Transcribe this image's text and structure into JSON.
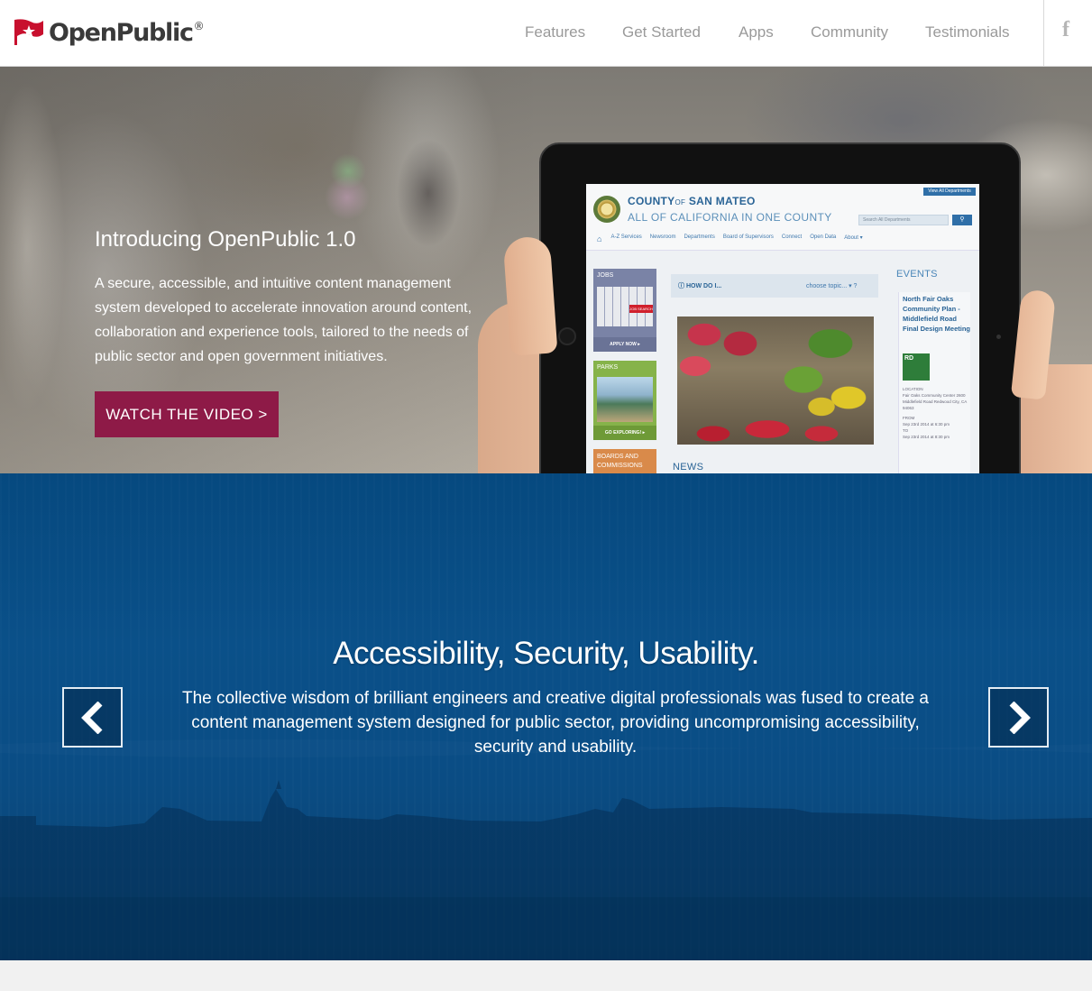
{
  "header": {
    "logo_text": "OpenPublic",
    "logo_reg": "®",
    "nav": [
      {
        "label": "Features"
      },
      {
        "label": "Get Started"
      },
      {
        "label": "Apps"
      },
      {
        "label": "Community"
      },
      {
        "label": "Testimonials"
      }
    ],
    "social_icon": "facebook-icon",
    "social_glyph": "f"
  },
  "hero": {
    "title": "Introducing OpenPublic 1.0",
    "description": "A secure, accessible, and intuitive content management system developed to accelerate innovation around content, collaboration and experience tools, tailored to the needs of public sector and open government initiatives.",
    "cta_label": "WATCH THE VIDEO >",
    "cta_color": "#8e1a47"
  },
  "tablet_screen": {
    "county_prefix": "COUNTY",
    "county_of": "OF",
    "county_name": "SAN MATEO",
    "tagline": "ALL OF CALIFORNIA IN ONE COUNTY",
    "all_departments": "View All Departments",
    "search_placeholder": "Search All Departments",
    "nav": [
      "A-Z Services",
      "Newsroom",
      "Departments",
      "Board of Supervisors",
      "Connect",
      "Open Data",
      "About ▾"
    ],
    "tiles": [
      {
        "label": "JOBS",
        "action": "APPLY NOW ▸"
      },
      {
        "label": "PARKS",
        "action": "GO EXPLORING! ▸"
      },
      {
        "label": "BOARDS AND COMMISSIONS",
        "action": ""
      }
    ],
    "job_search": "JOB SEARCH",
    "how_do_i": "HOW DO I...",
    "choose_topic": "choose topic... ▾  ?",
    "events_heading": "EVENTS",
    "event_title": "North Fair Oaks Community Plan - Middlefield Road Final Design Meeting",
    "event_location_label": "LOCATION",
    "event_location": "Fair Oaks Community Center 2600 Middlefield Road Redwood City, CA 94063",
    "event_from_label": "FROM",
    "event_from": "Sep 23rd 2014 at 6:30 pm",
    "event_to_label": "TO",
    "event_to": "Sep 23rd 2014 at 8:30 pm",
    "news_heading": "NEWS"
  },
  "feature": {
    "title": "Accessibility, Security, Usability.",
    "description": "The collective wisdom of brilliant engineers and creative digital professionals was fused to create a content management system designed for public sector, providing uncompromising accessibility, security and usability.",
    "prev_icon": "chevron-left-icon",
    "next_icon": "chevron-right-icon",
    "band_color": "#0a4d85"
  },
  "colors": {
    "brand_red": "#c8102e",
    "nav_text": "#9a9a9a",
    "cta": "#8e1a47"
  }
}
